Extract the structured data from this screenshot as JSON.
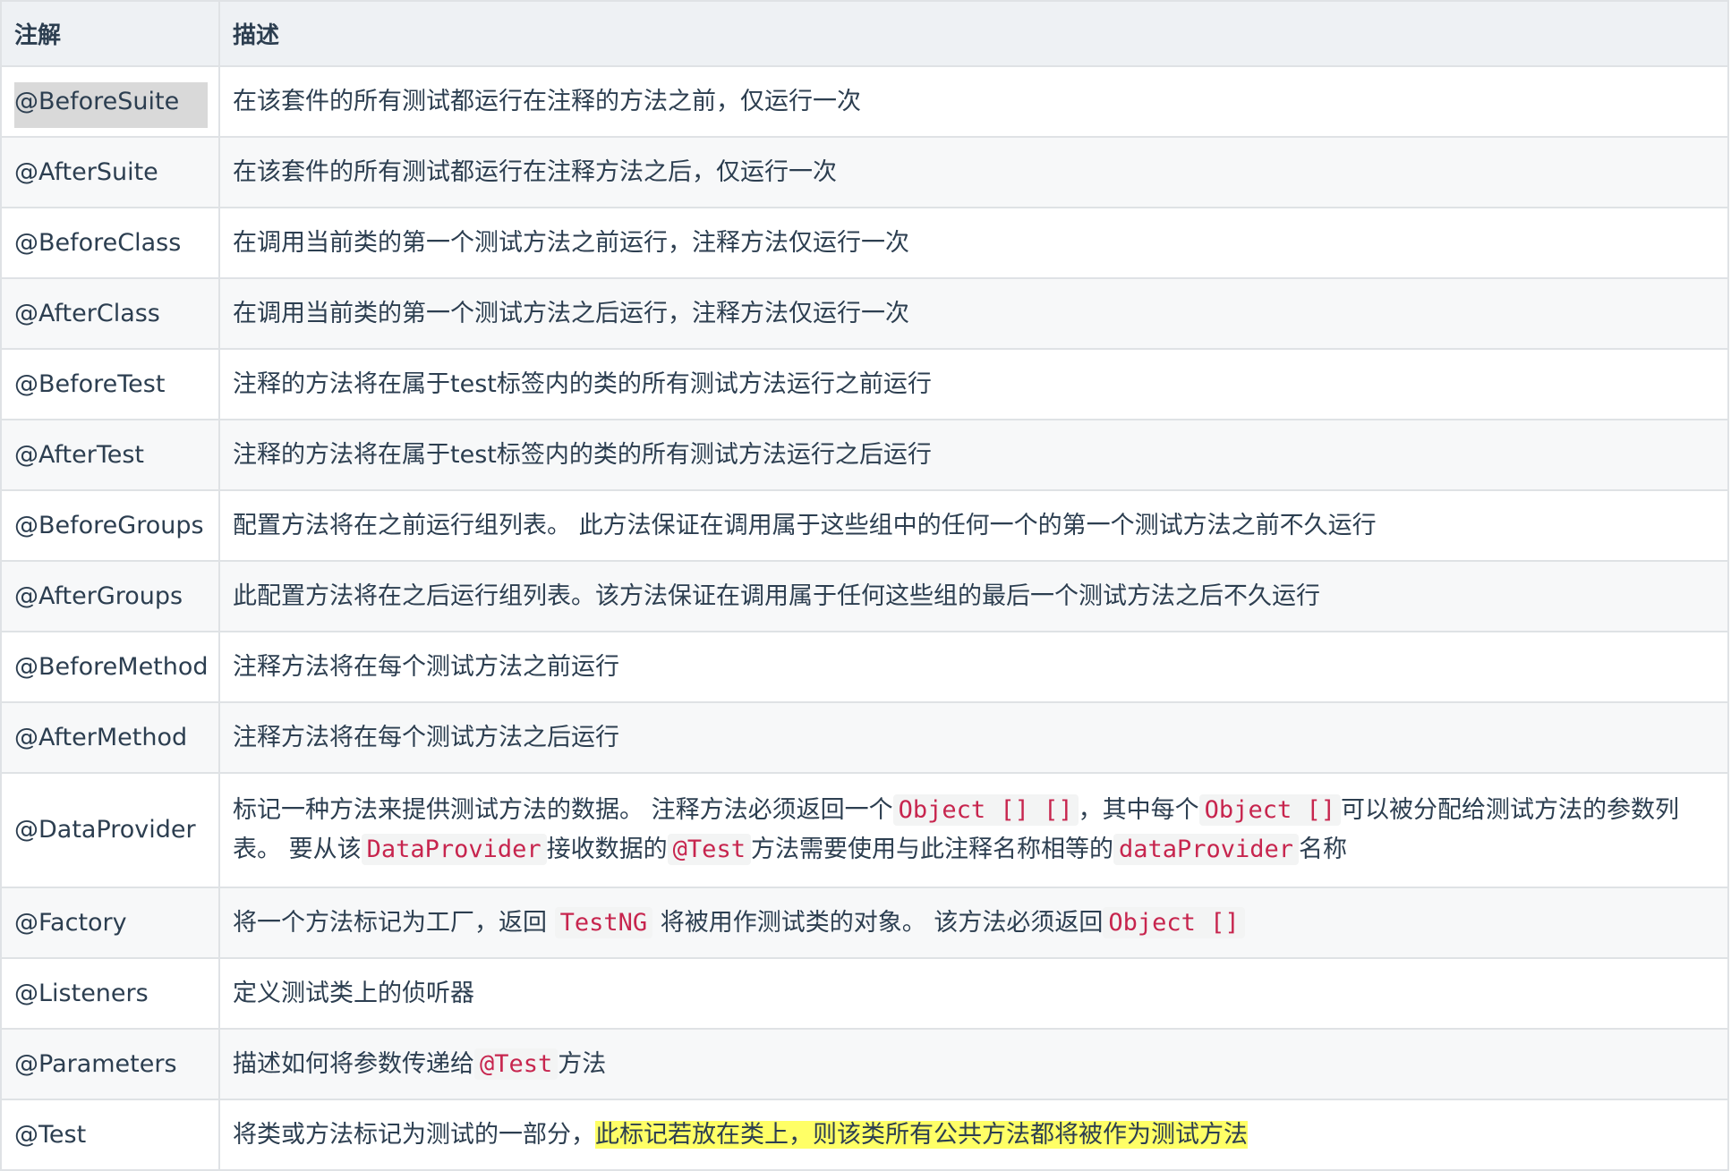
{
  "header": {
    "col1": "注解",
    "col2": "描述"
  },
  "rows": [
    {
      "annotation": "@BeforeSuite",
      "desc": "在该套件的所有测试都运行在注释的方法之前，仅运行一次"
    },
    {
      "annotation": "@AfterSuite",
      "desc": "在该套件的所有测试都运行在注释方法之后，仅运行一次"
    },
    {
      "annotation": "@BeforeClass",
      "desc": "在调用当前类的第一个测试方法之前运行，注释方法仅运行一次"
    },
    {
      "annotation": "@AfterClass",
      "desc": "在调用当前类的第一个测试方法之后运行，注释方法仅运行一次"
    },
    {
      "annotation": "@BeforeTest",
      "desc": "注释的方法将在属于test标签内的类的所有测试方法运行之前运行"
    },
    {
      "annotation": "@AfterTest",
      "desc": "注释的方法将在属于test标签内的类的所有测试方法运行之后运行"
    },
    {
      "annotation": "@BeforeGroups",
      "desc": "配置方法将在之前运行组列表。 此方法保证在调用属于这些组中的任何一个的第一个测试方法之前不久运行"
    },
    {
      "annotation": "@AfterGroups",
      "desc": "此配置方法将在之后运行组列表。该方法保证在调用属于任何这些组的最后一个测试方法之后不久运行"
    },
    {
      "annotation": "@BeforeMethod",
      "desc": "注释方法将在每个测试方法之前运行"
    },
    {
      "annotation": "@AfterMethod",
      "desc": "注释方法将在每个测试方法之后运行"
    },
    {
      "annotation": "@DataProvider",
      "desc_parts": {
        "t1": "标记一种方法来提供测试方法的数据。 注释方法必须返回一个",
        "c1": "Object [] []",
        "t2": "，其中每个",
        "c2": "Object []",
        "t3": "可以被分配给测试方法的参数列表。 要从该",
        "c3": "DataProvider",
        "t4": "接收数据的",
        "c4": "@Test",
        "t5": "方法需要使用与此注释名称相等的",
        "c5": "dataProvider",
        "t6": "名称"
      }
    },
    {
      "annotation": "@Factory",
      "desc_parts": {
        "t1": "将一个方法标记为工厂，返回",
        "c1": "TestNG",
        "t2": "将被用作测试类的对象。 该方法必须返回",
        "c2": "Object []"
      }
    },
    {
      "annotation": "@Listeners",
      "desc": "定义测试类上的侦听器"
    },
    {
      "annotation": "@Parameters",
      "desc_parts": {
        "t1": "描述如何将参数传递给",
        "c1": "@Test",
        "t2": "方法"
      }
    },
    {
      "annotation": "@Test",
      "desc_parts": {
        "t1": "将类或方法标记为测试的一部分，",
        "h1": "此标记若放在类上，则该类所有公共方法都将被作为测试方法"
      }
    }
  ]
}
